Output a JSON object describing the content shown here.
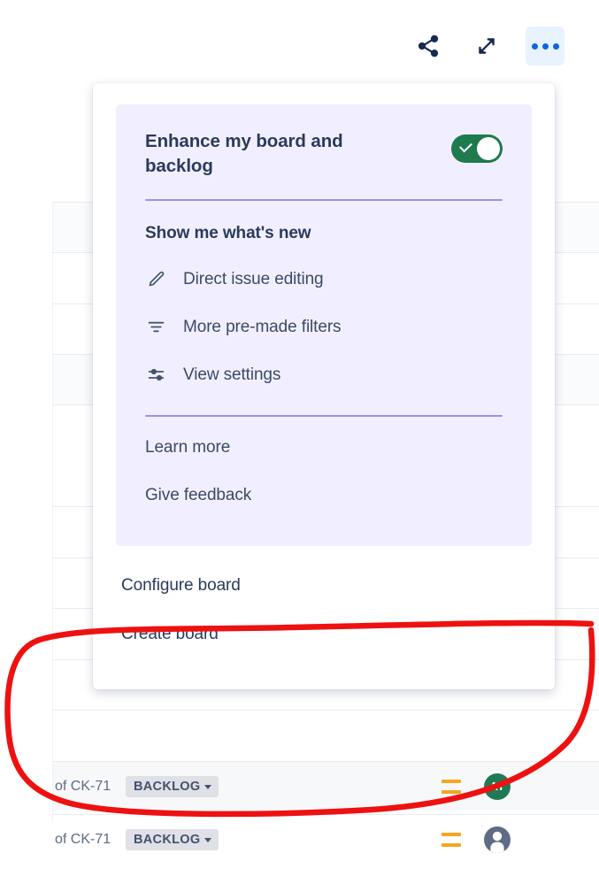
{
  "toolbar": {
    "buttons": [
      {
        "name": "share-icon",
        "label": "Share"
      },
      {
        "name": "expand-icon",
        "label": "Expand"
      },
      {
        "name": "more-options-icon",
        "label": "More options"
      }
    ]
  },
  "more_menu": {
    "enhance_card": {
      "title": "Enhance my board and backlog",
      "toggle_state": "on",
      "whats_new_title": "Show me what's new",
      "features": [
        {
          "icon": "pencil-icon",
          "label": "Direct issue editing"
        },
        {
          "icon": "filter-icon",
          "label": "More pre-made filters"
        },
        {
          "icon": "sliders-icon",
          "label": "View settings"
        }
      ],
      "links": [
        {
          "label": "Learn more"
        },
        {
          "label": "Give feedback"
        }
      ]
    },
    "actions": [
      {
        "label": "Configure board"
      },
      {
        "label": "Create board"
      }
    ]
  },
  "backlog_rows": [
    {
      "issue_key": "of CK-71",
      "status": "BACKLOG",
      "priority": "medium",
      "avatar_type": "initials",
      "avatar_text": "AT"
    },
    {
      "issue_key": "of CK-71",
      "status": "BACKLOG",
      "priority": "medium",
      "avatar_type": "anonymous",
      "avatar_text": ""
    }
  ],
  "annotation": {
    "type": "hand-drawn-ellipse",
    "color": "#ee1111",
    "highlights": "Configure board / Create board menu actions"
  },
  "colors": {
    "accent_blue": "#0c66e4",
    "toggle_green": "#1f7a4d",
    "card_lavender": "#f1efff",
    "divider_purple": "#9f8fef",
    "text_navy": "#2a3b5c",
    "priority_orange": "#f5a623",
    "annotation_red": "#ee1111"
  }
}
